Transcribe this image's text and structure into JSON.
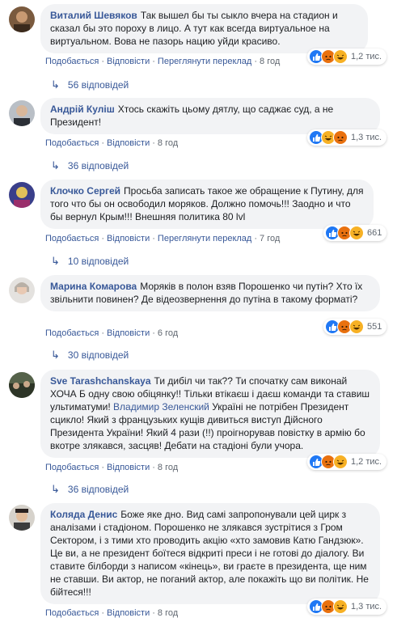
{
  "comments": [
    {
      "author": "Виталий Шевяков",
      "text": "Так вышел бы ты сыкло вчера на стадион и сказал бы это пороху в лицо. А тут как всегда виртуальное на виртуальном. Вова не пазорь нацию уйди красиво.",
      "like": "Подобається",
      "reply": "Відповісти",
      "translate": "Переглянути переклад",
      "time": "8 год",
      "reactions_count": "1,2 тис.",
      "reactions": [
        "like",
        "angry",
        "haha"
      ],
      "replies": "56 відповідей"
    },
    {
      "author": "Андрій Куліш",
      "text": "Хтось скажіть цьому дятлу, що саджає суд, а не Президент!",
      "like": "Подобається",
      "reply": "Відповісти",
      "time": "8 год",
      "reactions_count": "1,3 тис.",
      "reactions": [
        "like",
        "haha",
        "angry"
      ],
      "replies": "36 відповідей"
    },
    {
      "author": "Клочко Сергей",
      "text": "Просьба записать такое же обращение к Путину, для того что бы он освободил моряков. Должно помочь!!! Заодно и что бы вернул Крым!!! Внешняя политика 80 lvl",
      "like": "Подобається",
      "reply": "Відповісти",
      "translate": "Переглянути переклад",
      "time": "7 год",
      "reactions_count": "661",
      "reactions": [
        "like",
        "angry",
        "haha"
      ],
      "replies": "10 відповідей"
    },
    {
      "author": "Марина Комарова",
      "text": "Моряків в полон взяв Порошенко чи путін? Хто їх звільнити повинен? Де відеозвернення до путіна в такому форматі?",
      "like": "Подобається",
      "reply": "Відповісти",
      "time": "6 год",
      "reactions_count": "551",
      "reactions": [
        "like",
        "angry",
        "haha"
      ],
      "replies": "30 відповідей"
    },
    {
      "author": "Sve Tarashchanskaya",
      "text_before": "Ти дибіл чи так?? Ти спочатку сам виконай ХОЧА Б одну свою обіцянку!! Тільки втікаєш і даєш команди та ставиш ультиматуми! ",
      "mention": "Владимир Зеленский",
      "text_after": " Україні не потрібен Президент сцикло! Який з французьких кущів дивиться виступ Дійсного Президента України! Який 4 рази (!!) проігнорував повістку в армію бо вкотре злякався, засцяв! Дебати на стадіоні були учора.",
      "like": "Подобається",
      "reply": "Відповісти",
      "time": "8 год",
      "reactions_count": "1,2 тис.",
      "reactions": [
        "like",
        "angry",
        "haha"
      ],
      "replies": "36 відповідей"
    },
    {
      "author": "Коляда Денис",
      "text": "Боже яке дно. Вид самі запропонували цей цирк з аналізами і стадіоном. Порошенко не злякався зустрітися з Гром Сектором, і з тими хто проводить акцію «хто замовив Катю Гандзюк». Це ви, а не президент боїтеся відкриті преси і не готові до діалогу. Ви ставите білборди з написом «кінець», ви граєте в президента, ще ним не ставши. Ви актор, не поганий актор, але покажіть що ви політик. Не бійтеся!!!",
      "like": "Подобається",
      "reply": "Відповісти",
      "time": "8 год",
      "reactions_count": "1,3 тис.",
      "reactions": [
        "like",
        "angry",
        "haha"
      ]
    }
  ],
  "colors": {
    "link": "#385898",
    "bubble": "#f2f3f5",
    "like": "#2078f4",
    "angry": "#e9710f",
    "haha": "#f7b125"
  }
}
